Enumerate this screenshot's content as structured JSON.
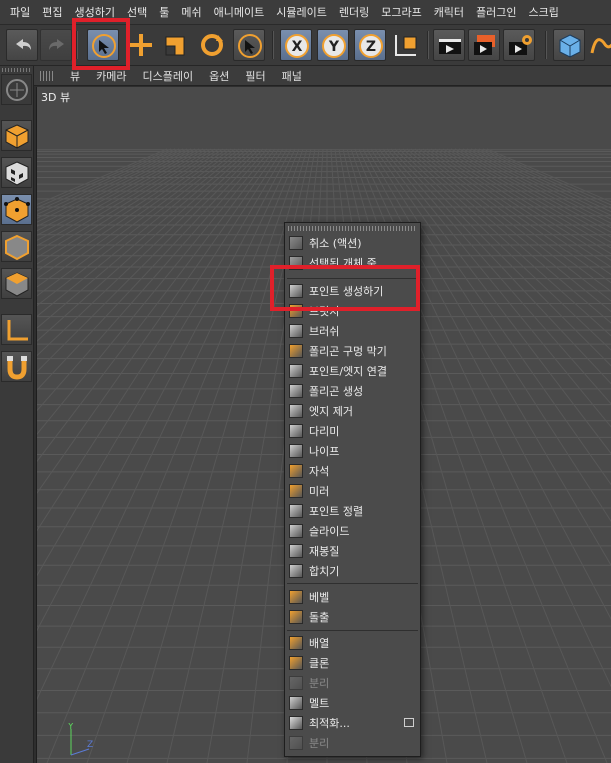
{
  "menubar": {
    "items": [
      "파일",
      "편집",
      "생성하기",
      "선택",
      "툴",
      "메쉬",
      "애니메이트",
      "시뮬레이트",
      "렌더링",
      "모그라프",
      "캐릭터",
      "플러그인",
      "스크립"
    ]
  },
  "toolbar": {
    "buttons": [
      "undo-icon",
      "redo-icon",
      "live-selection-icon",
      "move-icon",
      "scale-icon",
      "rotate-icon",
      "select-icon",
      "x-axis-icon",
      "y-axis-icon",
      "z-axis-icon",
      "world-coordinates-icon",
      "render-view-icon",
      "render-picture-viewer-icon",
      "render-settings-icon",
      "cube-icon",
      "spline-icon"
    ],
    "axis_labels": [
      "X",
      "Y",
      "Z"
    ]
  },
  "viewport_menu": {
    "items": [
      "뷰",
      "카메라",
      "디스플레이",
      "옵션",
      "필터",
      "패널"
    ]
  },
  "viewport": {
    "label": "3D 뷰",
    "axis_y": "Y",
    "axis_z": "Z"
  },
  "context_menu": {
    "items": [
      {
        "label": "취소 (액션)",
        "icon": "undo-action-icon"
      },
      {
        "label": "선택된 개체 줌",
        "icon": "zoom-selected-icon"
      },
      {
        "label": "포인트 생성하기",
        "icon": "create-point-icon"
      },
      {
        "label": "브릿지",
        "icon": "bridge-icon"
      },
      {
        "label": "브러쉬",
        "icon": "brush-icon"
      },
      {
        "label": "폴리곤 구멍 막기",
        "icon": "close-polygon-hole-icon"
      },
      {
        "label": "포인트/엣지 연결",
        "icon": "connect-points-edges-icon"
      },
      {
        "label": "폴리곤 생성",
        "icon": "create-polygon-icon"
      },
      {
        "label": "엣지 제거",
        "icon": "dissolve-edge-icon"
      },
      {
        "label": "다리미",
        "icon": "iron-icon"
      },
      {
        "label": "나이프",
        "icon": "knife-icon"
      },
      {
        "label": "자석",
        "icon": "magnet-icon"
      },
      {
        "label": "미러",
        "icon": "mirror-icon"
      },
      {
        "label": "포인트 정렬",
        "icon": "set-point-value-icon"
      },
      {
        "label": "슬라이드",
        "icon": "slide-icon"
      },
      {
        "label": "재봉질",
        "icon": "stitch-and-sew-icon"
      },
      {
        "label": "합치기",
        "icon": "weld-icon"
      },
      {
        "label": "베벨",
        "icon": "bevel-icon"
      },
      {
        "label": "돌출",
        "icon": "extrude-icon"
      },
      {
        "label": "배열",
        "icon": "array-icon"
      },
      {
        "label": "클론",
        "icon": "clone-icon"
      },
      {
        "label": "분리",
        "icon": "disconnect-icon",
        "disabled": true
      },
      {
        "label": "멜트",
        "icon": "melt-icon"
      },
      {
        "label": "최적화...",
        "icon": "optimize-icon"
      },
      {
        "label": "분리",
        "icon": "split-icon",
        "disabled": true
      }
    ]
  },
  "colors": {
    "highlight": "#e0202a",
    "accent_orange": "#f0a030",
    "active_blue": "#6a7f9e"
  }
}
